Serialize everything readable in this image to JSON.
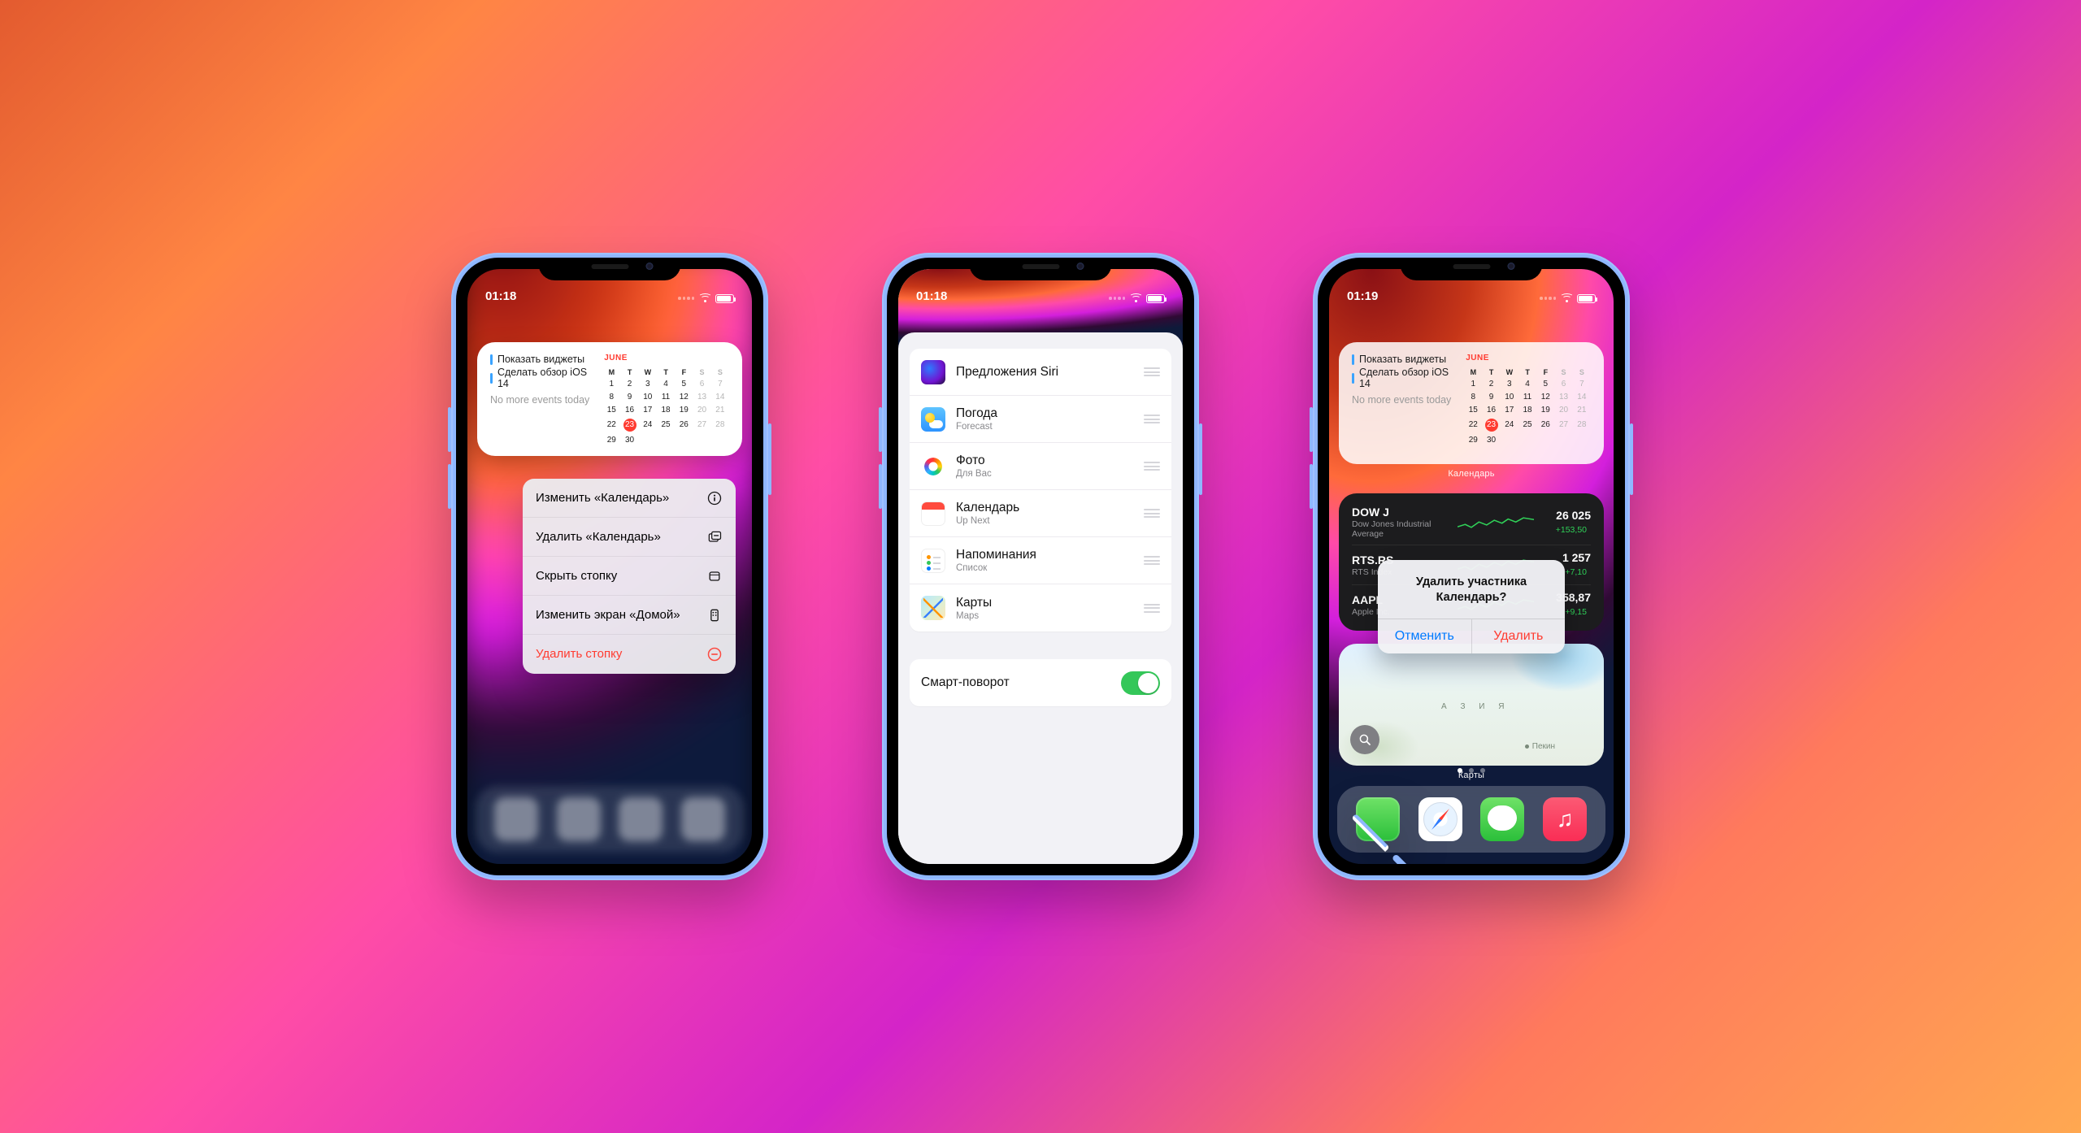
{
  "status": {
    "time1": "01:18",
    "time2": "01:18",
    "time3": "01:19"
  },
  "calendar": {
    "month": "JUNE",
    "weekdays": [
      "M",
      "T",
      "W",
      "T",
      "F",
      "S",
      "S"
    ],
    "event1": "Показать виджеты",
    "event2": "Сделать обзор iOS 14",
    "nomore": "No more events today",
    "today": 23,
    "widget_label": "Календарь"
  },
  "context_menu": {
    "edit_widget": "Изменить «Календарь»",
    "remove_widget": "Удалить «Календарь»",
    "hide_stack": "Скрыть стопку",
    "edit_home": "Изменить экран «Домой»",
    "remove_stack": "Удалить стопку"
  },
  "widget_list": {
    "siri": {
      "title": "Предложения Siri",
      "sub": ""
    },
    "weather": {
      "title": "Погода",
      "sub": "Forecast"
    },
    "photos": {
      "title": "Фото",
      "sub": "Для Вас"
    },
    "calendar": {
      "title": "Календарь",
      "sub": "Up Next"
    },
    "reminders": {
      "title": "Напоминания",
      "sub": "Список"
    },
    "maps": {
      "title": "Карты",
      "sub": "Maps"
    },
    "smart_rotate": "Смарт-поворот"
  },
  "stocks": {
    "rows": [
      {
        "sym": "DOW J",
        "name": "Dow Jones Industrial Average",
        "price": "26 025",
        "delta": "+153,50"
      },
      {
        "sym": "RTS.RS",
        "name": "RTS Index",
        "price": "1 257",
        "delta": "+7,10"
      },
      {
        "sym": "AAPL",
        "name": "Apple Inc.",
        "price": "358,87",
        "delta": "+9,15"
      }
    ]
  },
  "map": {
    "label": "Карты",
    "asia": "А З И Я",
    "pekin": "Пекин"
  },
  "dialog": {
    "message": "Удалить участника Календарь?",
    "cancel": "Отменить",
    "delete": "Удалить"
  }
}
